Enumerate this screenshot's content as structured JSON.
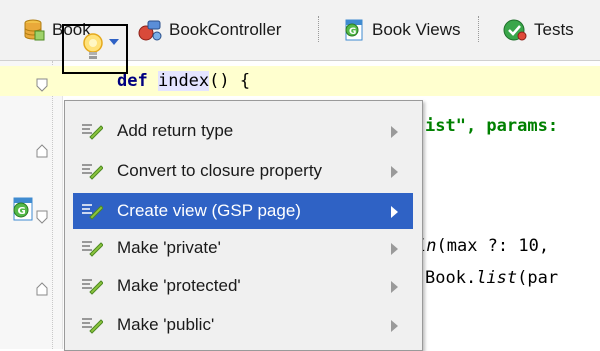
{
  "toolbar": {
    "tabs": [
      {
        "label": "Book",
        "icon": "database-icon"
      },
      {
        "label": "BookController",
        "icon": "controller-icon"
      },
      {
        "label": "Book Views",
        "icon": "views-icon"
      },
      {
        "label": "Tests",
        "icon": "tests-icon"
      }
    ]
  },
  "editor": {
    "line1": {
      "keyword": "def",
      "name": "index",
      "rest": "() {"
    },
    "line2": {
      "text": "ist\", params:"
    },
    "line3": {
      "italic": "in",
      "rest": "(max ?: 10,"
    },
    "line4": {
      "prefix": "Book.",
      "italic": "list",
      "rest": "(par"
    }
  },
  "intention_menu": {
    "items": [
      {
        "label": "Add return type",
        "selected": false
      },
      {
        "label": "Convert to closure property",
        "selected": false
      },
      {
        "label": "Create view (GSP page)",
        "selected": true
      },
      {
        "label": "Make 'private'",
        "selected": false
      },
      {
        "label": "Make 'protected'",
        "selected": false
      },
      {
        "label": "Make 'public'",
        "selected": false
      }
    ]
  },
  "colors": {
    "selection": "#2f62c5",
    "highlight_line": "#ffffcf",
    "keyword": "#000080",
    "string": "#008000"
  }
}
